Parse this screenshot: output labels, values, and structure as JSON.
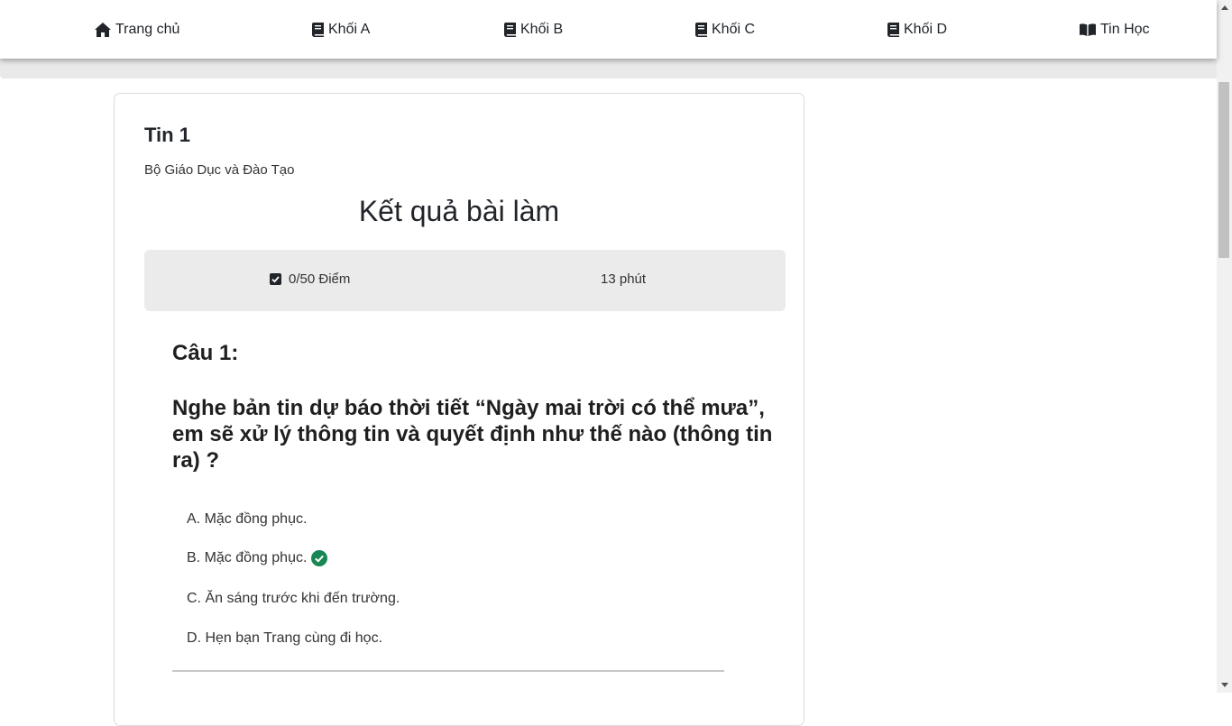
{
  "nav": {
    "items": [
      {
        "label": "Trang chủ",
        "icon": "home-icon"
      },
      {
        "label": "Khối A",
        "icon": "book-icon"
      },
      {
        "label": "Khối B",
        "icon": "book-icon"
      },
      {
        "label": "Khối C",
        "icon": "book-icon"
      },
      {
        "label": "Khối D",
        "icon": "book-icon"
      },
      {
        "label": "Tin Học",
        "icon": "book-open-icon"
      }
    ]
  },
  "card": {
    "title": "Tin 1",
    "subtitle": "Bộ Giáo Dục và Đào Tạo",
    "result_heading": "Kết quả bài làm",
    "score": "0/50 Điểm",
    "time": "13 phút"
  },
  "question": {
    "number": "Câu 1:",
    "text": "Nghe bản tin dự báo thời tiết “Ngày mai trời có thể mưa”, em sẽ xử lý thông tin và quyết định như thế nào (thông tin ra) ?",
    "options": [
      {
        "label": "A. Mặc đồng phục.",
        "correct": false
      },
      {
        "label": "B. Mặc đồng phục.",
        "correct": true
      },
      {
        "label": "C. Ăn sáng trước khi đến trường.",
        "correct": false
      },
      {
        "label": "D. Hẹn bạn Trang cùng đi học.",
        "correct": false
      }
    ]
  },
  "colors": {
    "correct": "#198754",
    "summary_bg": "#ebebeb",
    "text": "#212529"
  }
}
